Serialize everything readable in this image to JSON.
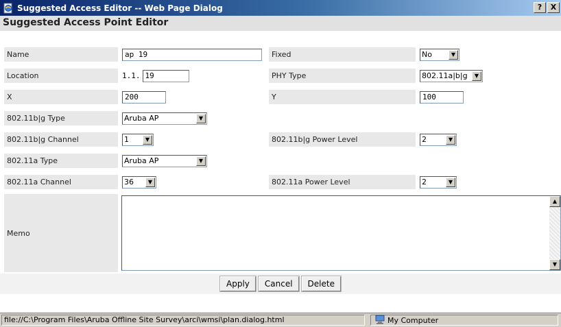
{
  "window": {
    "title": "Suggested Access Editor -- Web Page Dialog",
    "help_btn": "?",
    "close_btn": "X"
  },
  "heading": "Suggested Access Point Editor",
  "fields": {
    "name_label": "Name",
    "name_value": "ap 19",
    "fixed_label": "Fixed",
    "fixed_value": "No",
    "location_label": "Location",
    "location_prefix": "1.1.",
    "location_value": "19",
    "phy_label": "PHY Type",
    "phy_value": "802.11a|b|g",
    "x_label": "X",
    "x_value": "200",
    "y_label": "Y",
    "y_value": "100",
    "bg_type_label": "802.11b|g Type",
    "bg_type_value": "Aruba AP",
    "bg_channel_label": "802.11b|g Channel",
    "bg_channel_value": "1",
    "bg_power_label": "802.11b|g Power Level",
    "bg_power_value": "2",
    "a_type_label": "802.11a Type",
    "a_type_value": "Aruba AP",
    "a_channel_label": "802.11a Channel",
    "a_channel_value": "36",
    "a_power_label": "802.11a Power Level",
    "a_power_value": "2",
    "memo_label": "Memo",
    "memo_value": ""
  },
  "buttons": {
    "apply": "Apply",
    "cancel": "Cancel",
    "delete": "Delete"
  },
  "status": {
    "url": "file://C:\\Program Files\\Aruba Offline Site Survey\\arci\\wmsi\\plan.dialog.html",
    "zone": "My Computer"
  }
}
